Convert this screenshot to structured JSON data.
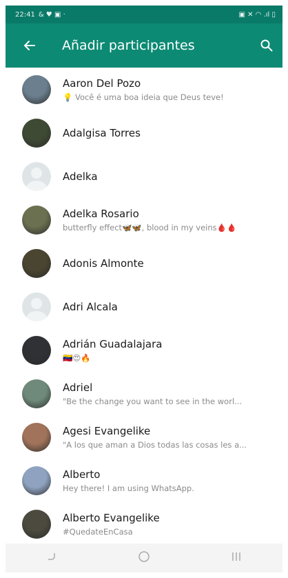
{
  "status_bar": {
    "time": "22:41",
    "left_icons": "& ♥ ▣ ·",
    "right_icons": "▣ ✕ ◠ .ıl ▯"
  },
  "app_bar": {
    "title": "Añadir participantes"
  },
  "contacts": [
    {
      "name": "Aaron Del Pozo",
      "status": "💡 Você é uma boa ideia que Deus teve!",
      "avatar_color": "#6b7f8e"
    },
    {
      "name": "Adalgisa Torres",
      "status": "",
      "avatar_color": "#3e4a33"
    },
    {
      "name": "Adelka",
      "status": "",
      "avatar_color": ""
    },
    {
      "name": "Adelka Rosario",
      "status": "butterfly effect🦋🦋, blood in my veins🩸🩸",
      "avatar_color": "#6a7050"
    },
    {
      "name": "Adonis Almonte",
      "status": "",
      "avatar_color": "#4a4530"
    },
    {
      "name": "Adri Alcala",
      "status": "",
      "avatar_color": ""
    },
    {
      "name": "Adrián Guadalajara",
      "status": "🇻🇪😍🔥",
      "avatar_color": "#2f3134"
    },
    {
      "name": "Adriel",
      "status": "\"Be the change you want to see in the worl...",
      "avatar_color": "#6f8a7a"
    },
    {
      "name": "Agesi Evangelike",
      "status": "\"A los que aman a Dios todas las cosas les a...",
      "avatar_color": "#a0735a"
    },
    {
      "name": "Alberto",
      "status": "Hey there! I am using WhatsApp.",
      "avatar_color": "#8fa3c0"
    },
    {
      "name": "Alberto Evangelike",
      "status": "#QuedateEnCasa",
      "avatar_color": "#4c4a3e"
    }
  ],
  "colors": {
    "header": "#0d8a74",
    "status_bar": "#0a7a68"
  }
}
